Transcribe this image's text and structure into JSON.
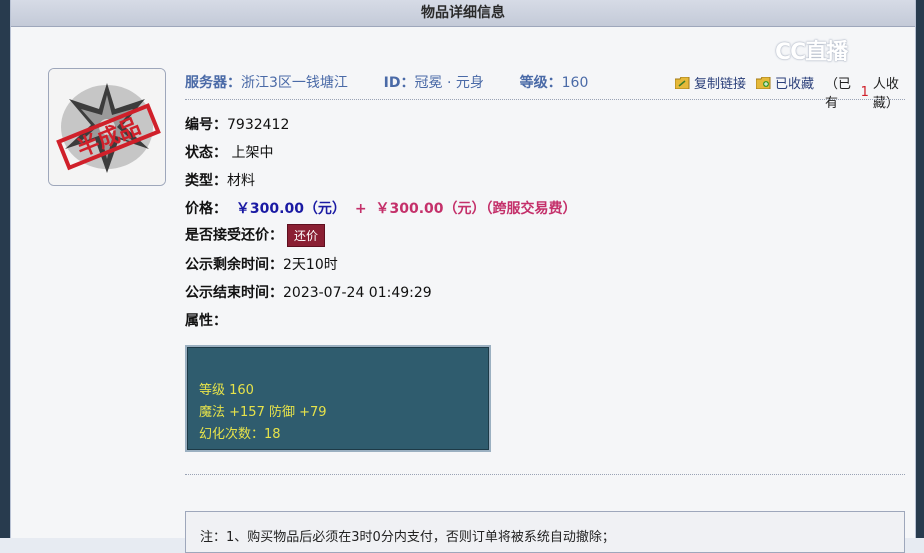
{
  "header": {
    "title": "物品详细信息"
  },
  "watermark": {
    "text": "CC直播"
  },
  "item": {
    "server_label": "服务器：",
    "server_value": "浙江3区一钱塘江",
    "id_label": "ID：",
    "id_value": "冠冕 · 元身",
    "level_label": "等级：",
    "level_value": "160",
    "stamp_text": "半成品"
  },
  "actions": {
    "copy_link": "复制链接",
    "favorited": "已收藏",
    "fav_count_prefix": "（已有",
    "fav_count": "1",
    "fav_count_suffix": "人收藏）"
  },
  "details": {
    "code_label": "编号：",
    "code_value": "7932412",
    "status_label": "状态：",
    "status_value": "上架中",
    "type_label": "类型：",
    "type_value": "材料",
    "price_label": "价格：",
    "price_value": "￥300.00（元）",
    "price_plus": "+",
    "fee_value": "￥300.00（元）（跨服交易费）",
    "bargain_label": "是否接受还价：",
    "bargain_button": "还价",
    "remaining_label": "公示剩余时间：",
    "remaining_value": "2天10时",
    "end_label": "公示结束时间：",
    "end_value": "2023-07-24 01:49:29",
    "attr_label": "属性："
  },
  "attributes": {
    "line1": "等级 160",
    "line2": "魔法 +157 防御 +79",
    "line3": "幻化次数：18"
  },
  "note": {
    "text": "注：1、购买物品后必须在3时0分内支付，否则订单将被系统自动撤除；"
  },
  "colors": {
    "label_blue": "#4a6aa7",
    "price_blue": "#1a1aa3",
    "price_red": "#c4306a",
    "button_bg": "#8a1f33",
    "attr_bg": "#2f5c6e",
    "attr_text": "#e6e24a"
  }
}
